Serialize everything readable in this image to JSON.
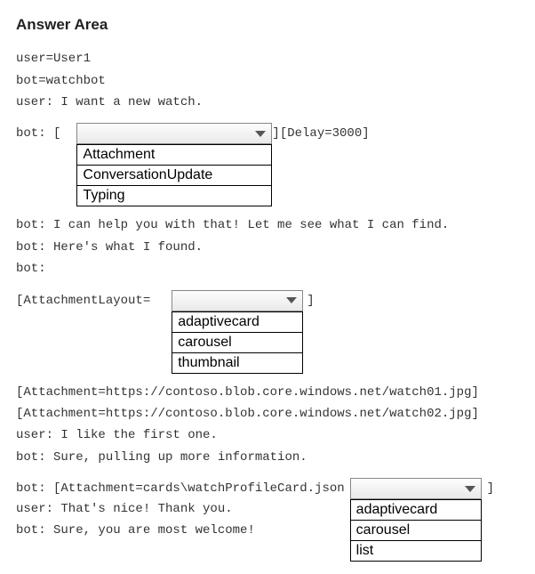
{
  "title": "Answer Area",
  "lines": {
    "l1": "user=User1",
    "l2": "bot=watchbot",
    "l3": "user: I want a new watch.",
    "l4_prefix": "bot: [",
    "l4_suffix": "][Delay=3000]",
    "l5": "bot: I can help you with that! Let me see what I can find.",
    "l6": "bot: Here's what I found.",
    "l7": "bot:",
    "l8_prefix": "[AttachmentLayout=",
    "l8_suffix": "]",
    "l9": "[Attachment=https://contoso.blob.core.windows.net/watch01.jpg]",
    "l10": "[Attachment=https://contoso.blob.core.windows.net/watch02.jpg]",
    "l11": "user: I like the first one.",
    "l12": "bot: Sure, pulling up more information.",
    "l13_prefix": "bot: [Attachment=cards\\watchProfileCard.json",
    "l13_suffix": "]",
    "l14": "user: That's nice! Thank you.",
    "l15": "bot: Sure, you are most welcome!"
  },
  "dropdown1": {
    "selected": "",
    "options": [
      "Attachment",
      "ConversationUpdate",
      "Typing"
    ],
    "width_btn": 220,
    "width_opts": 220
  },
  "dropdown2": {
    "selected": "",
    "options": [
      "adaptivecard",
      "carousel",
      "thumbnail"
    ],
    "width_btn": 148,
    "width_opts": 148
  },
  "dropdown3": {
    "selected": "",
    "options": [
      "adaptivecard",
      "carousel",
      "list"
    ],
    "width_btn": 148,
    "width_opts": 148
  }
}
